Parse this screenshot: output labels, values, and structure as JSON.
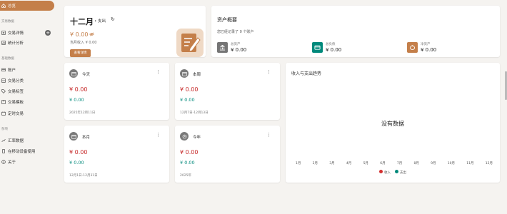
{
  "sidebar": {
    "active": "总览",
    "section_data": "交易数据",
    "detail": "交易详情",
    "stats": "统计分析",
    "section_basic": "基础数据",
    "accounts": "账户",
    "categories": "交易分类",
    "tags": "交易标签",
    "templates": "交易模板",
    "scheduled": "定时交易",
    "section_misc": "杂项",
    "exchange": "汇率数据",
    "mobile": "在移动设备使用",
    "about": "关于"
  },
  "month_card": {
    "title": "十二月",
    "sub": "• 支出",
    "amount": "¥ 0.00",
    "income": "当月收入 ¥ 0.00",
    "button": "查看详情"
  },
  "overview": {
    "title": "资产概要",
    "sub": "您已经记录了 0 个账户",
    "stats": [
      {
        "label": "总资产",
        "value": "¥ 0.00",
        "color": "#757575"
      },
      {
        "label": "总负债",
        "value": "¥ 0.00",
        "color": "#00897b"
      },
      {
        "label": "净资产",
        "value": "¥ 0.00",
        "color": "#c47f4a"
      }
    ]
  },
  "periods": [
    {
      "name": "今天",
      "expense": "¥ 0.00",
      "income": "¥ 0.00",
      "date": "2025年12月11日"
    },
    {
      "name": "本周",
      "expense": "¥ 0.00",
      "income": "¥ 0.00",
      "date": "12月7日-12月13日"
    },
    {
      "name": "本月",
      "expense": "¥ 0.00",
      "income": "¥ 0.00",
      "date": "12月1日-12月31日"
    },
    {
      "name": "今年",
      "expense": "¥ 0.00",
      "income": "¥ 0.00",
      "date": "2025年"
    }
  ],
  "trend": {
    "title": "收入与支出趋势",
    "empty": "没有数据",
    "months": [
      "1月",
      "2月",
      "3月",
      "4月",
      "5月",
      "6月",
      "7月",
      "8月",
      "9月",
      "10月",
      "11月",
      "12月"
    ],
    "legend_income": "收入",
    "legend_expense": "支出",
    "income_color": "#d32f2f",
    "expense_color": "#00897b"
  },
  "colors": {
    "accent": "#c47f4a",
    "expense": "#c62828",
    "income": "#00897b"
  }
}
